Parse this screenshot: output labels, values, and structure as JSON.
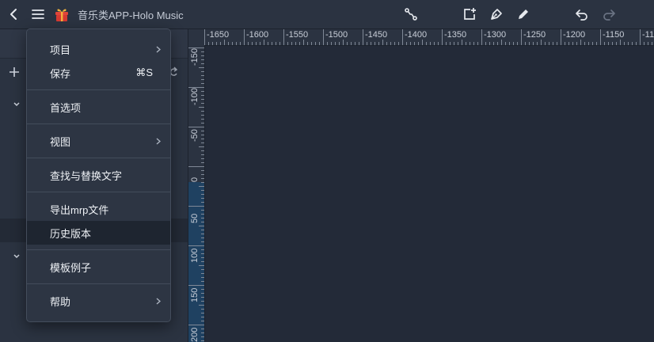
{
  "app": {
    "title": "音乐类APP-Holo Music"
  },
  "menu": {
    "items": [
      {
        "label": "项目",
        "shortcut": "",
        "submenu": true
      },
      {
        "label": "保存",
        "shortcut": "⌘S",
        "submenu": false
      },
      {
        "label": "首选项",
        "shortcut": "",
        "submenu": false
      },
      {
        "label": "视图",
        "shortcut": "",
        "submenu": true
      },
      {
        "label": "查找与替换文字",
        "shortcut": "",
        "submenu": false
      },
      {
        "label": "导出mrp文件",
        "shortcut": "",
        "submenu": false
      },
      {
        "label": "历史版本",
        "shortcut": "",
        "submenu": false,
        "hovered": true
      },
      {
        "label": "模板例子",
        "shortcut": "",
        "submenu": false
      },
      {
        "label": "帮助",
        "shortcut": "",
        "submenu": true
      }
    ]
  },
  "ruler": {
    "top": [
      "-1650",
      "-1600",
      "-1550",
      "-1500",
      "-1450",
      "-1400",
      "-1350",
      "-1300",
      "-1250",
      "-1200",
      "-1150",
      "-11"
    ],
    "left": [
      "-150",
      "-100",
      "-50",
      "0",
      "50",
      "100",
      "150",
      "200"
    ]
  },
  "icons": {
    "back": "chevron-left-icon",
    "menu": "hamburger-icon",
    "project": "gift-icon",
    "connect": "connector-icon",
    "frame": "add-frame-icon",
    "pen": "pen-tool-icon",
    "pencil": "pencil-icon",
    "undo": "undo-icon",
    "redo": "redo-icon"
  },
  "colors": {
    "background": "#232a38",
    "panel": "#2b3341",
    "menu": "#2d3543",
    "ruler_highlight": "#1f4161",
    "gift_red": "#e0453a",
    "gift_gold": "#f2b33d"
  }
}
